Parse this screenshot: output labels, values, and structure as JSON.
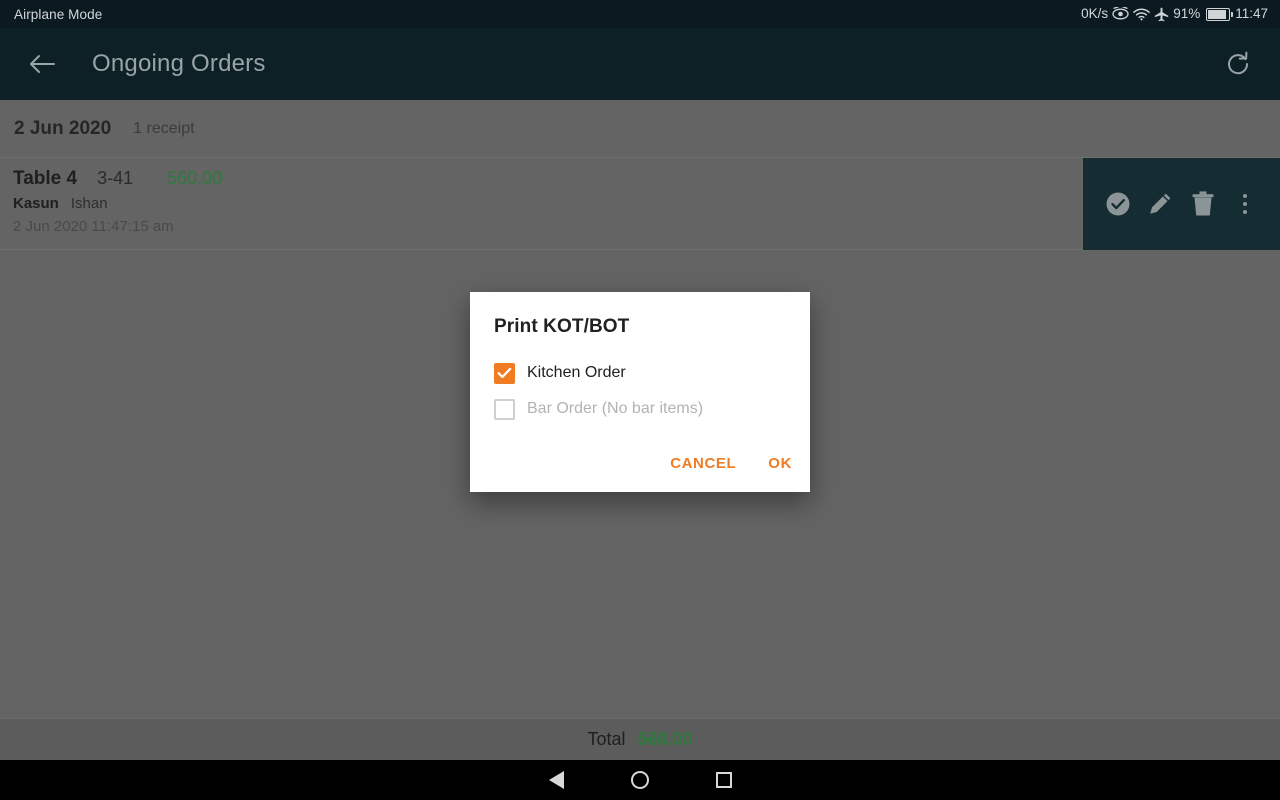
{
  "status_bar": {
    "left_label": "Airplane Mode",
    "network_speed": "0K/s",
    "battery_percent": "91%",
    "clock": "11:47",
    "icons": [
      "eye-slash-icon",
      "wifi-icon",
      "airplane-icon",
      "battery-icon"
    ]
  },
  "app_bar": {
    "back_icon": "back-arrow-icon",
    "title": "Ongoing Orders",
    "refresh_icon": "refresh-icon"
  },
  "list": {
    "date_header": {
      "date": "2 Jun 2020",
      "receipt_count": "1 receipt"
    },
    "orders": [
      {
        "table": "Table 4",
        "code": "3-41",
        "amount": "560.00",
        "first_name": "Kasun",
        "last_name": "Ishan",
        "timestamp": "2 Jun 2020 11:47:15 am",
        "actions": [
          "check-circle-icon",
          "edit-pencil-icon",
          "delete-trash-icon",
          "more-vertical-icon"
        ]
      }
    ]
  },
  "total_bar": {
    "label": "Total",
    "value": "560.00"
  },
  "dialog": {
    "title": "Print KOT/BOT",
    "options": [
      {
        "label": "Kitchen Order",
        "checked": true,
        "disabled": false
      },
      {
        "label": "Bar Order (No bar items)",
        "checked": false,
        "disabled": true
      }
    ],
    "cancel_label": "CANCEL",
    "ok_label": "OK"
  },
  "nav_bar": {
    "back": "nav-back-icon",
    "home": "nav-home-icon",
    "recents": "nav-recents-icon"
  },
  "colors": {
    "accent_orange": "#ef7b22",
    "amount_green": "#2f7a3e",
    "app_bar": "#0d2026",
    "status_bar": "#0a1a20",
    "actions_panel": "#152c33",
    "scrim_surface": "#646464"
  }
}
